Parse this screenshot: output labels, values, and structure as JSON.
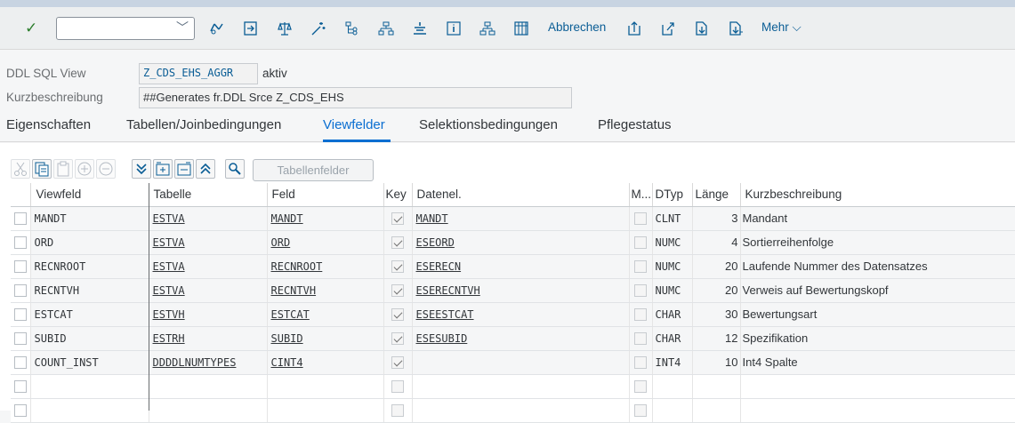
{
  "toolbar": {
    "command_value": "",
    "cancel_label": "Abbrechen",
    "more_label": "Mehr",
    "more_chevron": "⌵"
  },
  "header": {
    "view_label": "DDL SQL View",
    "view_value": "Z_CDS_EHS_AGGR",
    "view_status": "aktiv",
    "desc_label": "Kurzbeschreibung",
    "desc_value": "##Generates fr.DDL Srce Z_CDS_EHS"
  },
  "tabs": [
    {
      "label": "Eigenschaften"
    },
    {
      "label": "Tabellen/Joinbedingungen"
    },
    {
      "label": "Viewfelder"
    },
    {
      "label": "Selektionsbedingungen"
    },
    {
      "label": "Pflegestatus"
    }
  ],
  "panel": {
    "tablefields_label": "Tabellenfelder"
  },
  "grid": {
    "columns": [
      "Viewfeld",
      "Tabelle",
      "Feld",
      "Key",
      "Datenel.",
      "M...",
      "DTyp",
      "Länge",
      "Kurzbeschreibung"
    ],
    "rows": [
      {
        "viewfeld": "MANDT",
        "tabelle": "ESTVA",
        "feld": "MANDT",
        "key": true,
        "datenel": "MANDT",
        "dtyp": "CLNT",
        "laenge": "3",
        "desc": "Mandant"
      },
      {
        "viewfeld": "ORD",
        "tabelle": "ESTVA",
        "feld": "ORD",
        "key": true,
        "datenel": "ESEORD",
        "dtyp": "NUMC",
        "laenge": "4",
        "desc": "Sortierreihenfolge"
      },
      {
        "viewfeld": "RECNROOT",
        "tabelle": "ESTVA",
        "feld": "RECNROOT",
        "key": true,
        "datenel": "ESERECN",
        "dtyp": "NUMC",
        "laenge": "20",
        "desc": "Laufende Nummer des Datensatzes"
      },
      {
        "viewfeld": "RECNTVH",
        "tabelle": "ESTVA",
        "feld": "RECNTVH",
        "key": true,
        "datenel": "ESERECNTVH",
        "dtyp": "NUMC",
        "laenge": "20",
        "desc": "Verweis auf Bewertungskopf"
      },
      {
        "viewfeld": "ESTCAT",
        "tabelle": "ESTVH",
        "feld": "ESTCAT",
        "key": true,
        "datenel": "ESEESTCAT",
        "dtyp": "CHAR",
        "laenge": "30",
        "desc": "Bewertungsart"
      },
      {
        "viewfeld": "SUBID",
        "tabelle": "ESTRH",
        "feld": "SUBID",
        "key": true,
        "datenel": "ESESUBID",
        "dtyp": "CHAR",
        "laenge": "12",
        "desc": "Spezifikation"
      },
      {
        "viewfeld": "COUNT_INST",
        "tabelle": "DDDDLNUMTYPES",
        "feld": "CINT4",
        "key": true,
        "datenel": "",
        "dtyp": "INT4",
        "laenge": "10",
        "desc": "Int4 Spalte"
      }
    ],
    "empty_rows": 2
  }
}
